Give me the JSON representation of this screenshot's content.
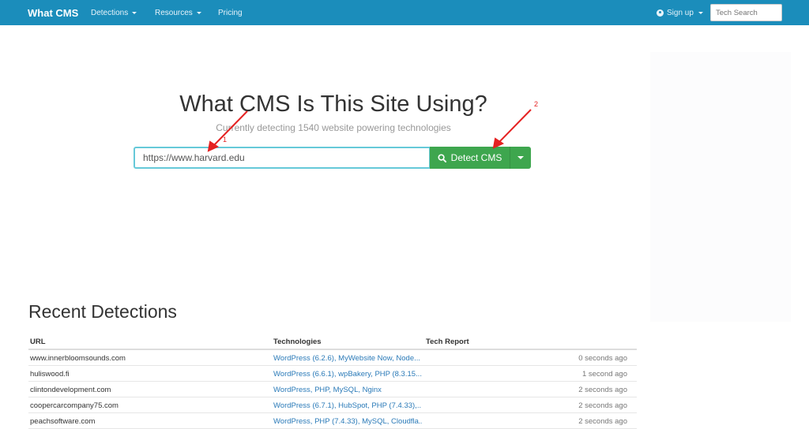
{
  "nav": {
    "brand": "What CMS",
    "links": [
      "Detections",
      "Resources",
      "Pricing"
    ],
    "signup": "Sign up",
    "search_placeholder": "Tech Search"
  },
  "hero": {
    "title": "What CMS Is This Site Using?",
    "subtitle": "Currently detecting 1540 website powering technologies",
    "url_value": "https://www.harvard.edu",
    "detect_label": "Detect CMS"
  },
  "annotations": [
    "1",
    "2"
  ],
  "recent": {
    "title": "Recent Detections",
    "headers": [
      "URL",
      "Technologies",
      "Tech Report"
    ],
    "rows": [
      {
        "url": "www.innerbloomsounds.com",
        "tech": "WordPress (6.2.6), MyWebsite Now, Node...",
        "time": "0 seconds ago"
      },
      {
        "url": "huliswood.fi",
        "tech": "WordPress (6.6.1), wpBakery, PHP (8.3.15...",
        "time": "1 second ago"
      },
      {
        "url": "clintondevelopment.com",
        "tech": "WordPress, PHP, MySQL, Nginx",
        "time": "2 seconds ago"
      },
      {
        "url": "coopercarcompany75.com",
        "tech": "WordPress (6.7.1), HubSpot, PHP (7.4.33),...",
        "time": "2 seconds ago"
      },
      {
        "url": "peachsoftware.com",
        "tech": "WordPress, PHP (7.4.33), MySQL, Cloudfla...",
        "time": "2 seconds ago"
      }
    ]
  },
  "colors": {
    "navbar": "#1b8dbb",
    "detect_button": "#3ea64e",
    "link": "#2a7ab8",
    "annotation": "#e52222"
  }
}
